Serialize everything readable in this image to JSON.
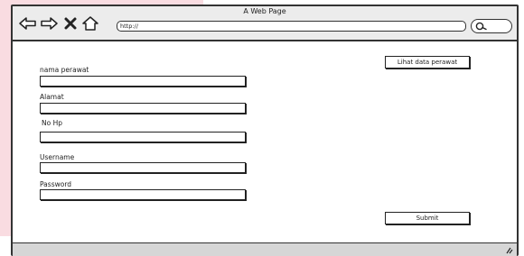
{
  "window": {
    "title": "A Web Page",
    "url": "http://"
  },
  "icons": {
    "back": "arrow-left-icon",
    "forward": "arrow-right-icon",
    "stop": "close-icon",
    "home": "home-icon",
    "search": "search-icon",
    "resize": "resize-grip-icon"
  },
  "form": {
    "fields": [
      {
        "label": "nama perawat",
        "value": ""
      },
      {
        "label": "Alamat",
        "value": ""
      },
      {
        "label": "No Hp",
        "value": ""
      },
      {
        "label": "Username",
        "value": ""
      },
      {
        "label": "Password",
        "value": ""
      }
    ],
    "submit_label": "Submit"
  },
  "actions": {
    "view_nurses_label": "Lihat data perawat"
  }
}
